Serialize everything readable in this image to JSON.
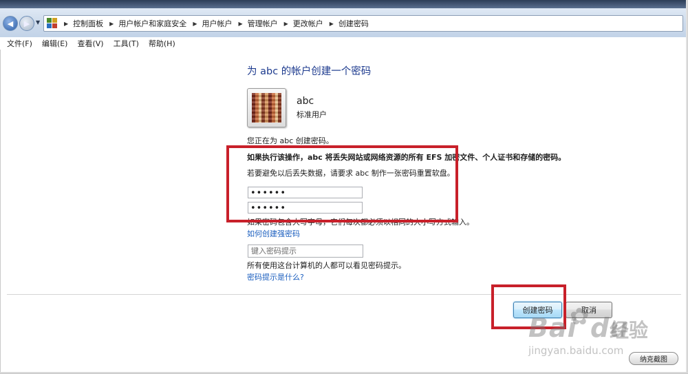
{
  "breadcrumb": [
    "控制面板",
    "用户帐户和家庭安全",
    "用户帐户",
    "管理帐户",
    "更改帐户",
    "创建密码"
  ],
  "menu": [
    "文件(F)",
    "编辑(E)",
    "查看(V)",
    "工具(T)",
    "帮助(H)"
  ],
  "page_title": "为 abc 的帐户创建一个密码",
  "user": {
    "name": "abc",
    "type": "标准用户"
  },
  "info": {
    "creating": "您正在为 abc 创建密码。",
    "warning": "如果执行该操作，abc 将丢失网站或网络资源的所有 EFS 加密文件、个人证书和存储的密码。",
    "reset_disk": "若要避免以后丢失数据，请要求 abc 制作一张密码重置软盘。"
  },
  "password": {
    "new_value": "••••••",
    "confirm_value": "••••••"
  },
  "case_note": "如果密码包含大写字母，它们每次都必须以相同的大小写方式输入。",
  "strong_link": "如何创建强密码",
  "hint": {
    "placeholder": "键入密码提示",
    "note": "所有使用这台计算机的人都可以看见密码提示。",
    "link": "密码提示是什么?"
  },
  "buttons": {
    "create": "创建密码",
    "cancel": "取消"
  },
  "annotation_color": "#c8202a",
  "watermark": {
    "brand": "Bai",
    "brand2": "du",
    "suffix": "经验",
    "url": "jingyan.baidu.com"
  },
  "snip_button": "纳克截图"
}
